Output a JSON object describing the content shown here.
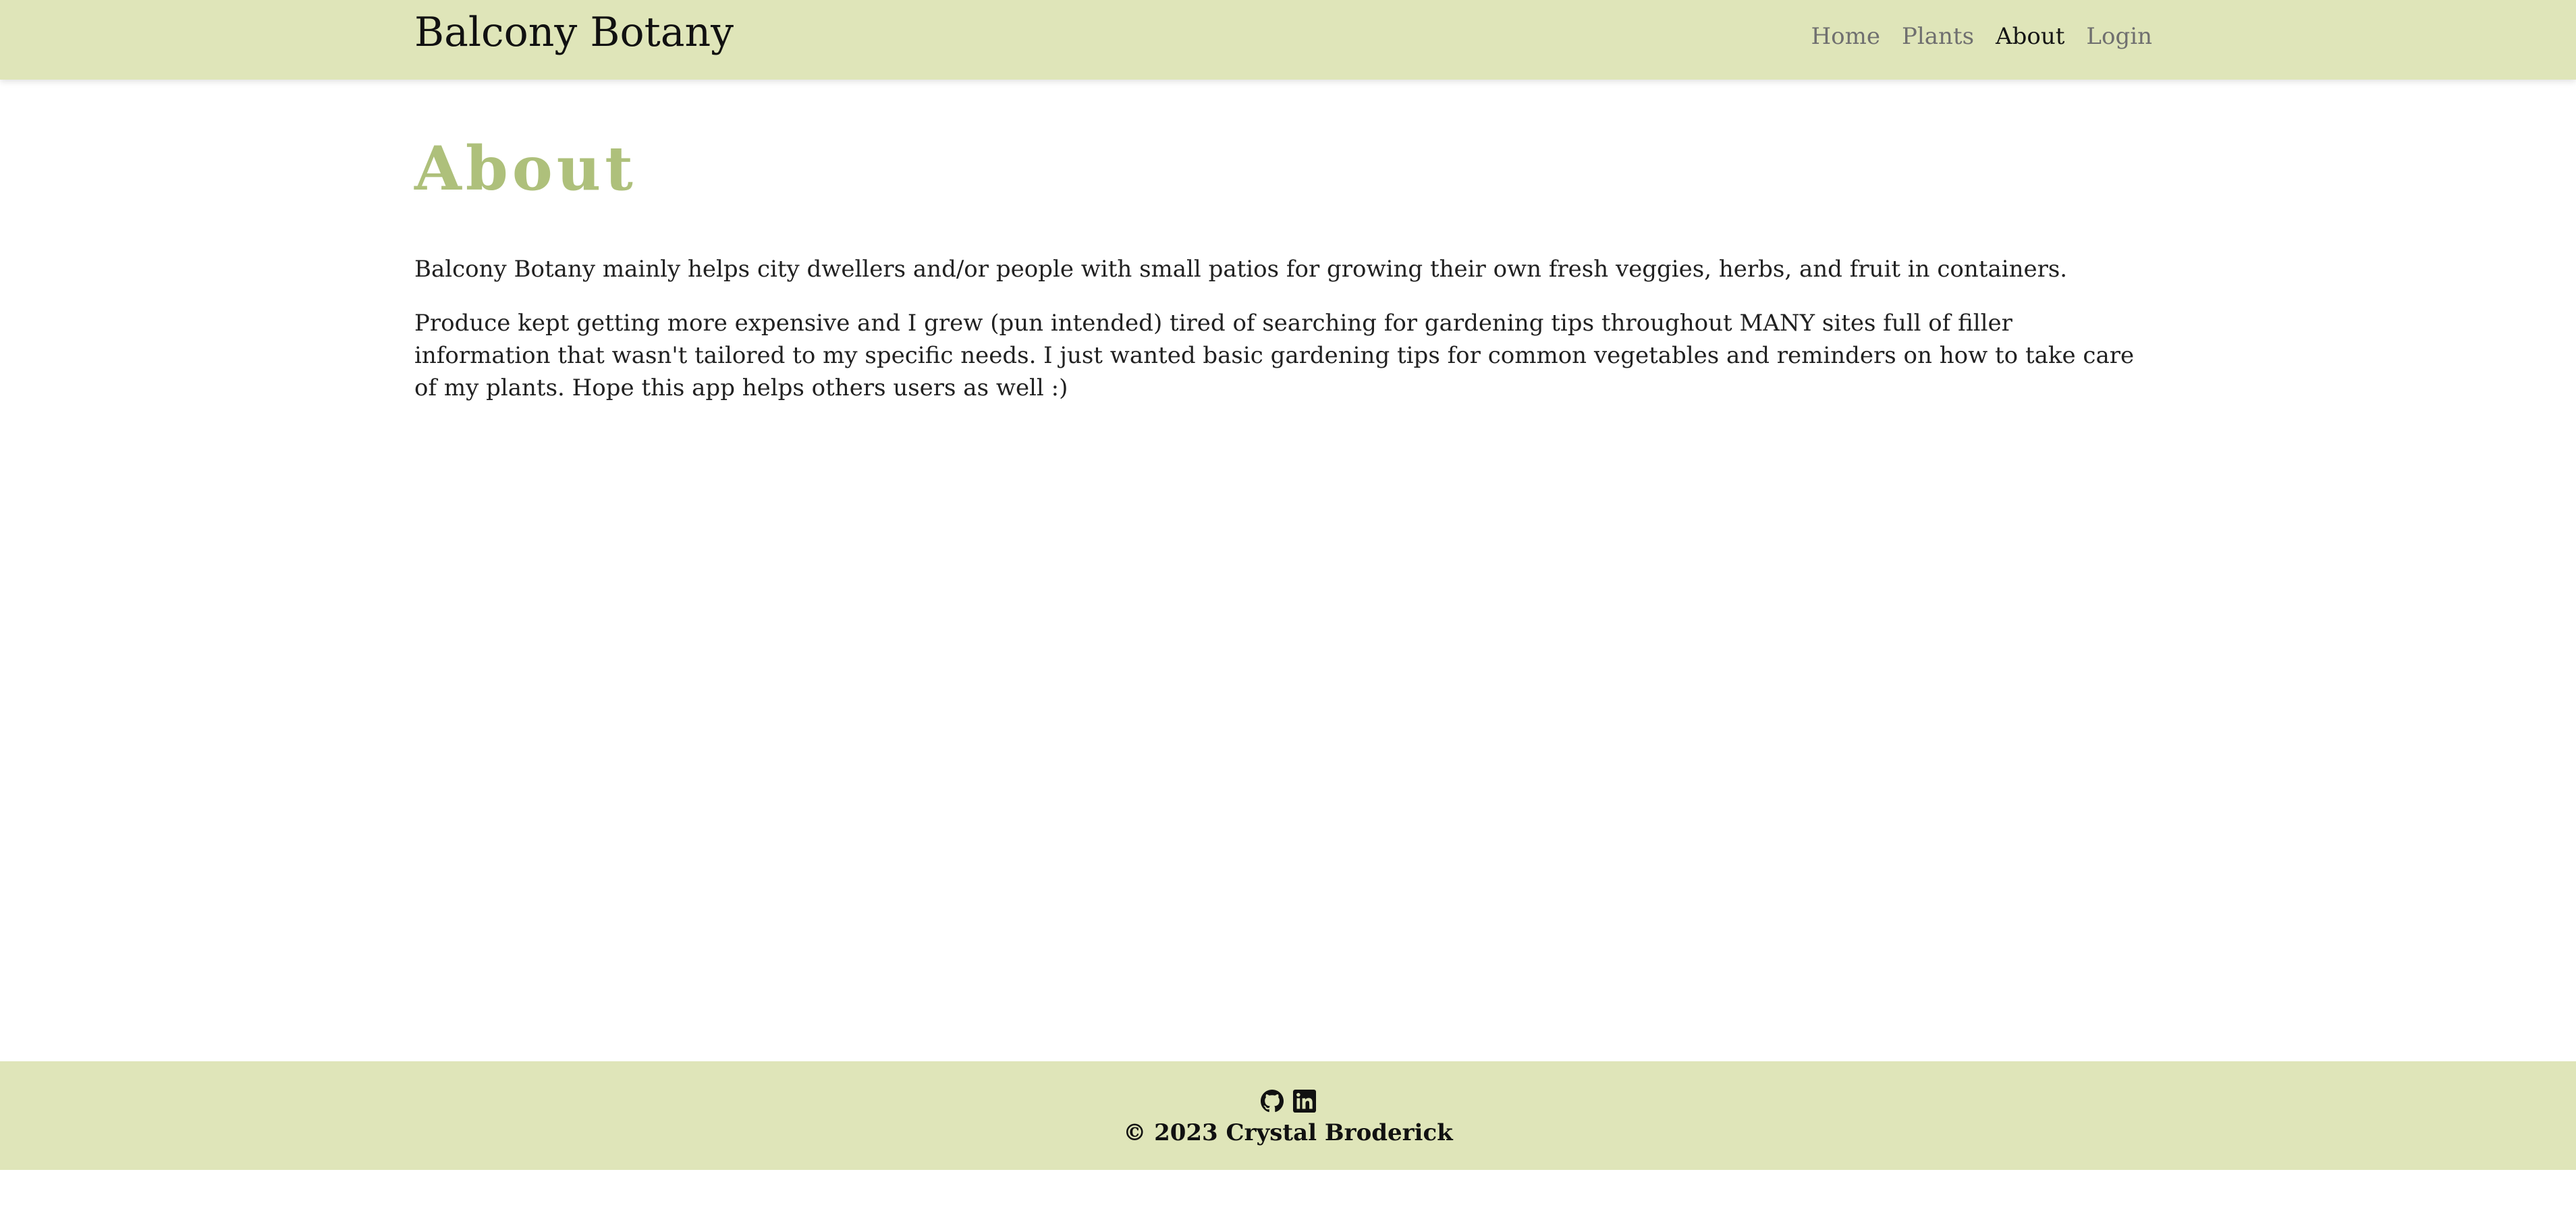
{
  "header": {
    "brand": "Balcony Botany",
    "nav": [
      {
        "label": "Home",
        "active": false
      },
      {
        "label": "Plants",
        "active": false
      },
      {
        "label": "About",
        "active": true
      },
      {
        "label": "Login",
        "active": false
      }
    ]
  },
  "main": {
    "title": "About",
    "paragraphs": [
      "Balcony Botany mainly helps city dwellers and/or people with small patios for growing their own fresh veggies, herbs, and fruit in containers.",
      "Produce kept getting more expensive and I grew (pun intended) tired of searching for gardening tips throughout MANY sites full of filler information that wasn't tailored to my specific needs. I just wanted basic gardening tips for common vegetables and reminders on how to take care of my plants. Hope this app helps others users as well :)"
    ]
  },
  "footer": {
    "icons": [
      "github-icon",
      "linkedin-icon"
    ],
    "copyright": "© 2023 Crystal Broderick"
  },
  "colors": {
    "header_bg": "#dfe5b9",
    "title_accent": "#aec07b",
    "nav_inactive": "#6f6f6f",
    "nav_active": "#141414",
    "text": "#212121"
  }
}
